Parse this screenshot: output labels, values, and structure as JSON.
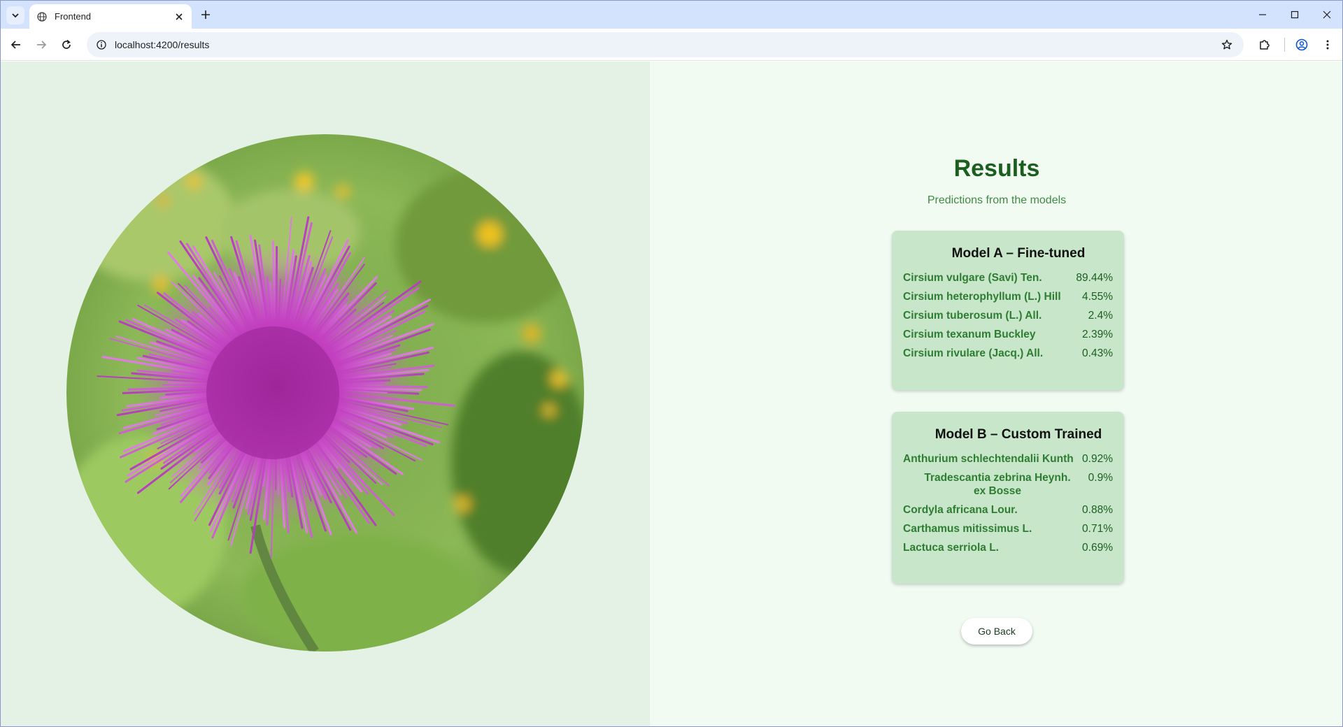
{
  "browser": {
    "tab_title": "Frontend",
    "url": "localhost:4200/results"
  },
  "results": {
    "title": "Results",
    "subtitle": "Predictions from the models"
  },
  "models": [
    {
      "title": "Model A – Fine-tuned",
      "predictions": [
        {
          "name": "Cirsium vulgare (Savi) Ten.",
          "value": "89.44%"
        },
        {
          "name": "Cirsium heterophyllum (L.) Hill",
          "value": "4.55%"
        },
        {
          "name": "Cirsium tuberosum (L.) All.",
          "value": "2.4%"
        },
        {
          "name": "Cirsium texanum Buckley",
          "value": "2.39%"
        },
        {
          "name": "Cirsium rivulare (Jacq.) All.",
          "value": "0.43%"
        }
      ]
    },
    {
      "title": "Model B – Custom Trained",
      "predictions": [
        {
          "name": "Anthurium schlechtendalii Kunth",
          "value": "0.92%"
        },
        {
          "name": "Tradescantia zebrina Heynh. ex Bosse",
          "value": "0.9%"
        },
        {
          "name": "Cordyla africana Lour.",
          "value": "0.88%"
        },
        {
          "name": "Carthamus mitissimus L.",
          "value": "0.71%"
        },
        {
          "name": "Lactuca serriola L.",
          "value": "0.69%"
        }
      ]
    }
  ],
  "actions": {
    "go_back_label": "Go Back"
  },
  "icons": {
    "tab_search": "chevron-down-icon",
    "favicon": "globe-icon",
    "tab_close": "close-icon",
    "new_tab": "plus-icon",
    "back": "arrow-left-icon",
    "forward": "arrow-right-icon",
    "reload": "reload-icon",
    "site_info": "info-icon",
    "bookmark": "star-icon",
    "extensions": "puzzle-icon",
    "profile": "account-icon",
    "menu": "kebab-menu-icon"
  },
  "colors": {
    "left_pane_bg": "#e3f2e5",
    "right_pane_bg": "#f1fbf2",
    "card_bg": "#c8e6c9",
    "title_green": "#1b5e20",
    "prediction_green": "#2e7d32"
  }
}
